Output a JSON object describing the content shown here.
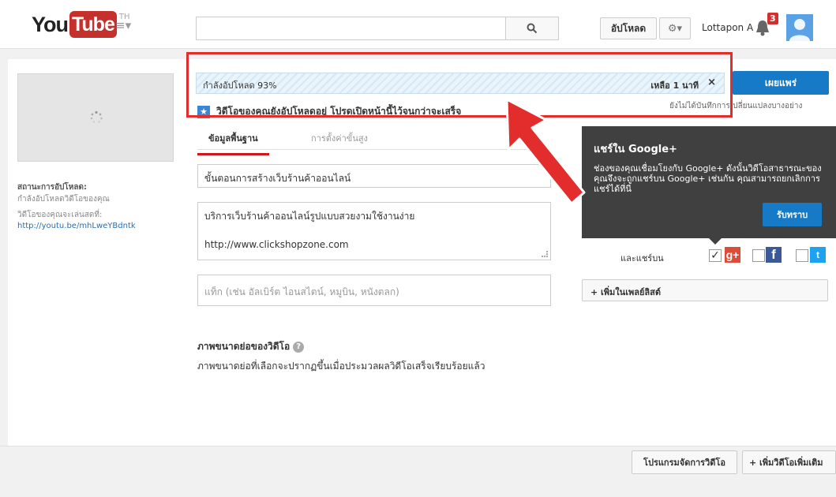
{
  "header": {
    "logo_you": "You",
    "logo_tube": "Tube",
    "logo_country": "TH",
    "search_placeholder": "",
    "upload_label": "อัปโหลด",
    "username": "Lottapon A",
    "notification_count": "3"
  },
  "left": {
    "status_title": "สถานะการอัปโหลด:",
    "status_sub": "กำลังอัปโหลดวิดีโอของคุณ",
    "live_prefix": "วิดีโอของคุณจะเล่นสดที่: ",
    "live_link": "http://youtu.be/mhLweYBdntk"
  },
  "upload": {
    "progress_label": "กำลังอัปโหลด 93%",
    "progress_percent": 93,
    "remaining": "เหลือ 1 นาที",
    "close": "×",
    "processing_text": "วิดีโอของคุณยังอัปโหลดอยู่ โปรดเปิดหน้านี้ไว้จนกว่าจะเสร็จ"
  },
  "tabs": [
    {
      "label": "ข้อมูลพื้นฐาน"
    },
    {
      "label": "การตั้งค่าขั้นสูง"
    }
  ],
  "form": {
    "title_value": "ขั้นตอนการสร้างเว็บร้านค้าออนไลน์",
    "description_value": "บริการเว็บร้านค้าออนไลน์รูปแบบสวยงามใช้งานง่าย\n\nhttp://www.clickshopzone.com",
    "tags_placeholder": "แท็ก (เช่น อัลเบิร์ต ไอนสไตน์, หมูบิน, หนังตลก)",
    "thumb_heading": "ภาพขนาดย่อของวิดีโอ",
    "thumb_note": "ภาพขนาดย่อที่เลือกจะปรากฏขึ้นเมื่อประมวลผลวิดีโอเสร็จเรียบร้อยแล้ว"
  },
  "right": {
    "publish_label": "เผยแพร่",
    "unsaved_note": "ยังไม่ได้บันทึกการเปลี่ยนแปลงบางอย่าง",
    "gplus_title": "แชร์ใน Google+",
    "gplus_body": "ช่องของคุณเชื่อมโยงกับ Google+ ดังนั้นวิดีโอสาธารณะของคุณจึงจะถูกแชร์บน Google+ เช่นกัน คุณสามารถยกเลิกการแชร์ได้ที่นี่",
    "gplus_ok": "รับทราบ",
    "share_label": "และแชร์บน",
    "gplus_checked": "✓",
    "playlist_label": "+ เพิ่มในเพลย์ลิสต์"
  },
  "bottom": {
    "manager_label": "โปรแกรมจัดการวิดีโอ",
    "add_more_label": "+ เพิ่มวิดีโอเพิ่มเติม"
  },
  "colors": {
    "brand_red": "#c4302b",
    "accent_blue": "#167ac6",
    "annotation_red": "#e32c2c"
  }
}
